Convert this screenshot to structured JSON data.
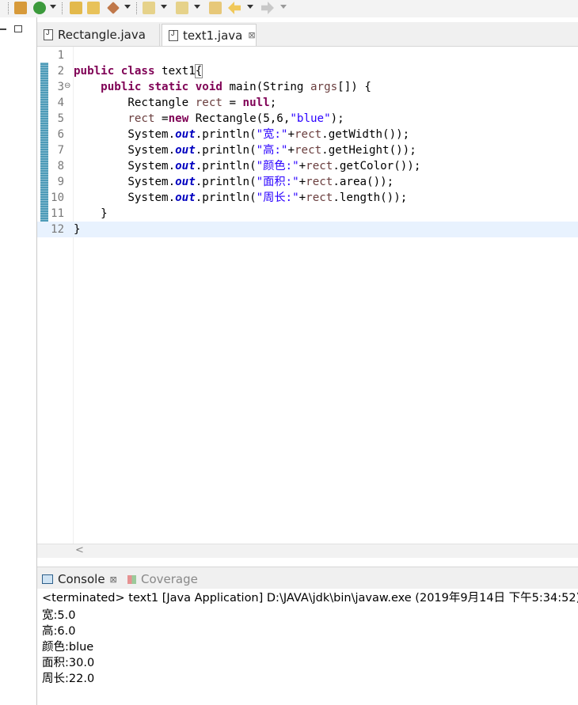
{
  "tabs": [
    {
      "label": "Rectangle.java",
      "active": false
    },
    {
      "label": "text1.java",
      "active": true
    }
  ],
  "tab_close_glyph": "⊠",
  "editor": {
    "line_numbers": [
      "1",
      "2",
      "3",
      "4",
      "5",
      "6",
      "7",
      "8",
      "9",
      "10",
      "11",
      "12"
    ],
    "current_line": 12
  },
  "console": {
    "tab_label": "Console",
    "tab_close_glyph": "⊠",
    "coverage_label": "Coverage",
    "status": "<terminated> text1 [Java Application] D:\\JAVA\\jdk\\bin\\javaw.exe (2019年9月14日 下午5:34:52)",
    "output": [
      "宽:5.0",
      "高:6.0",
      "颜色:blue",
      "面积:30.0",
      "周长:22.0"
    ]
  },
  "colors": {
    "keyword": "#7f0055",
    "string": "#2a00ff",
    "field": "#0000c0",
    "local_var": "#6a3e3e",
    "current_line": "#e8f2fe"
  },
  "icons": [
    "package-icon",
    "refresh-run-icon",
    "open-folder-icon",
    "open-type-icon",
    "launch-icon",
    "next-annotation-icon",
    "prev-annotation-icon",
    "last-edit-icon",
    "back-icon",
    "forward-icon",
    "minimize-icon",
    "maximize-icon",
    "java-file-icon",
    "console-icon",
    "coverage-icon",
    "fold-icon"
  ]
}
